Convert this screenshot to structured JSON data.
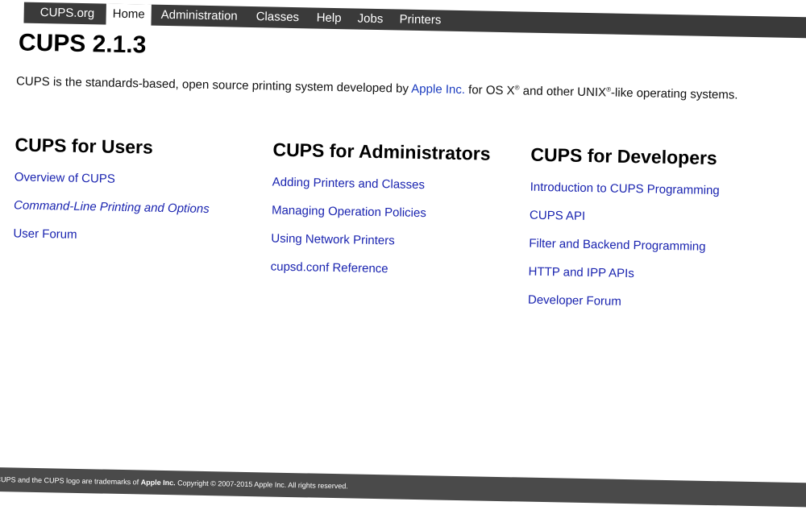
{
  "nav": {
    "items": [
      {
        "label": "CUPS.org"
      },
      {
        "label": "Home"
      },
      {
        "label": "Administration"
      },
      {
        "label": "Classes"
      },
      {
        "label": "Help"
      },
      {
        "label": "Jobs"
      },
      {
        "label": "Printers"
      }
    ],
    "active": "Home"
  },
  "header": {
    "title": "CUPS 2.1.3"
  },
  "intro": {
    "text_before": "CUPS is the standards-based, open source printing system developed by ",
    "link_label": "Apple Inc.",
    "text_mid": " for OS X",
    "reg1": "®",
    "text_mid2": " and other UNIX",
    "reg2": "®",
    "text_after": "-like operating systems."
  },
  "columns": [
    {
      "heading": "CUPS for Users",
      "links": [
        {
          "label": "Overview of CUPS"
        },
        {
          "label": "Command-Line Printing and Options"
        },
        {
          "label": "User Forum"
        }
      ]
    },
    {
      "heading": "CUPS for Administrators",
      "links": [
        {
          "label": "Adding Printers and Classes"
        },
        {
          "label": "Managing Operation Policies"
        },
        {
          "label": "Using Network Printers"
        },
        {
          "label": "cupsd.conf Reference"
        }
      ]
    },
    {
      "heading": "CUPS for Developers",
      "links": [
        {
          "label": "Introduction to CUPS Programming"
        },
        {
          "label": "CUPS API"
        },
        {
          "label": "Filter and Backend Programming"
        },
        {
          "label": "HTTP and IPP APIs"
        },
        {
          "label": "Developer Forum"
        }
      ]
    }
  ],
  "footer": {
    "text_before": "CUPS and the CUPS logo are trademarks of ",
    "company": "Apple Inc.",
    "text_after": " Copyright © 2007-2015 Apple Inc. All rights reserved."
  },
  "colors": {
    "nav_bg": "#3a3a3a",
    "link": "#1a24b0",
    "footer_bg": "#4a4a4a"
  }
}
